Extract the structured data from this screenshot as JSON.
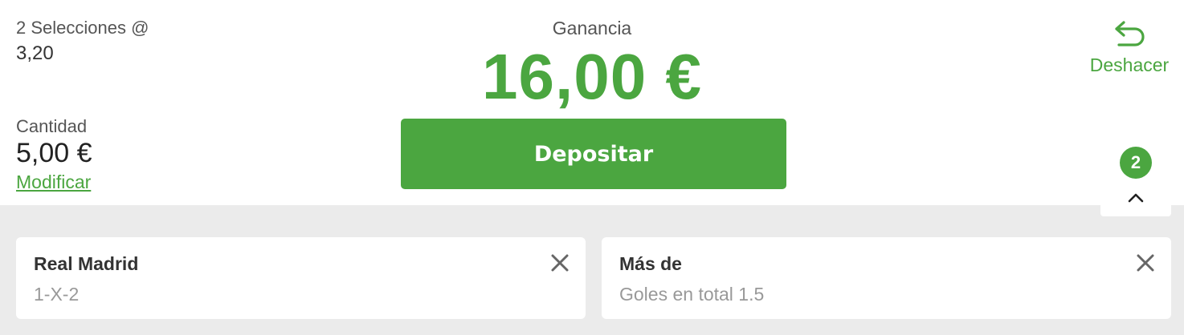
{
  "summary": {
    "selections_label": "2 Selecciones @",
    "odds": "3,20",
    "quantity_label": "Cantidad",
    "quantity_value": "5,00 €",
    "modify_label": "Modificar"
  },
  "gain": {
    "label": "Ganancia",
    "value": "16,00 €"
  },
  "deposit_label": "Depositar",
  "undo_label": "Deshacer",
  "toggle": {
    "badge": "2",
    "icon": "chevron-up-icon"
  },
  "selections": [
    {
      "title": "Real Madrid",
      "market": "1-X-2"
    },
    {
      "title": "Más de",
      "market": "Goles en total 1.5"
    }
  ],
  "colors": {
    "accent": "#4ba640",
    "background": "#ebebeb",
    "card": "#ffffff"
  }
}
